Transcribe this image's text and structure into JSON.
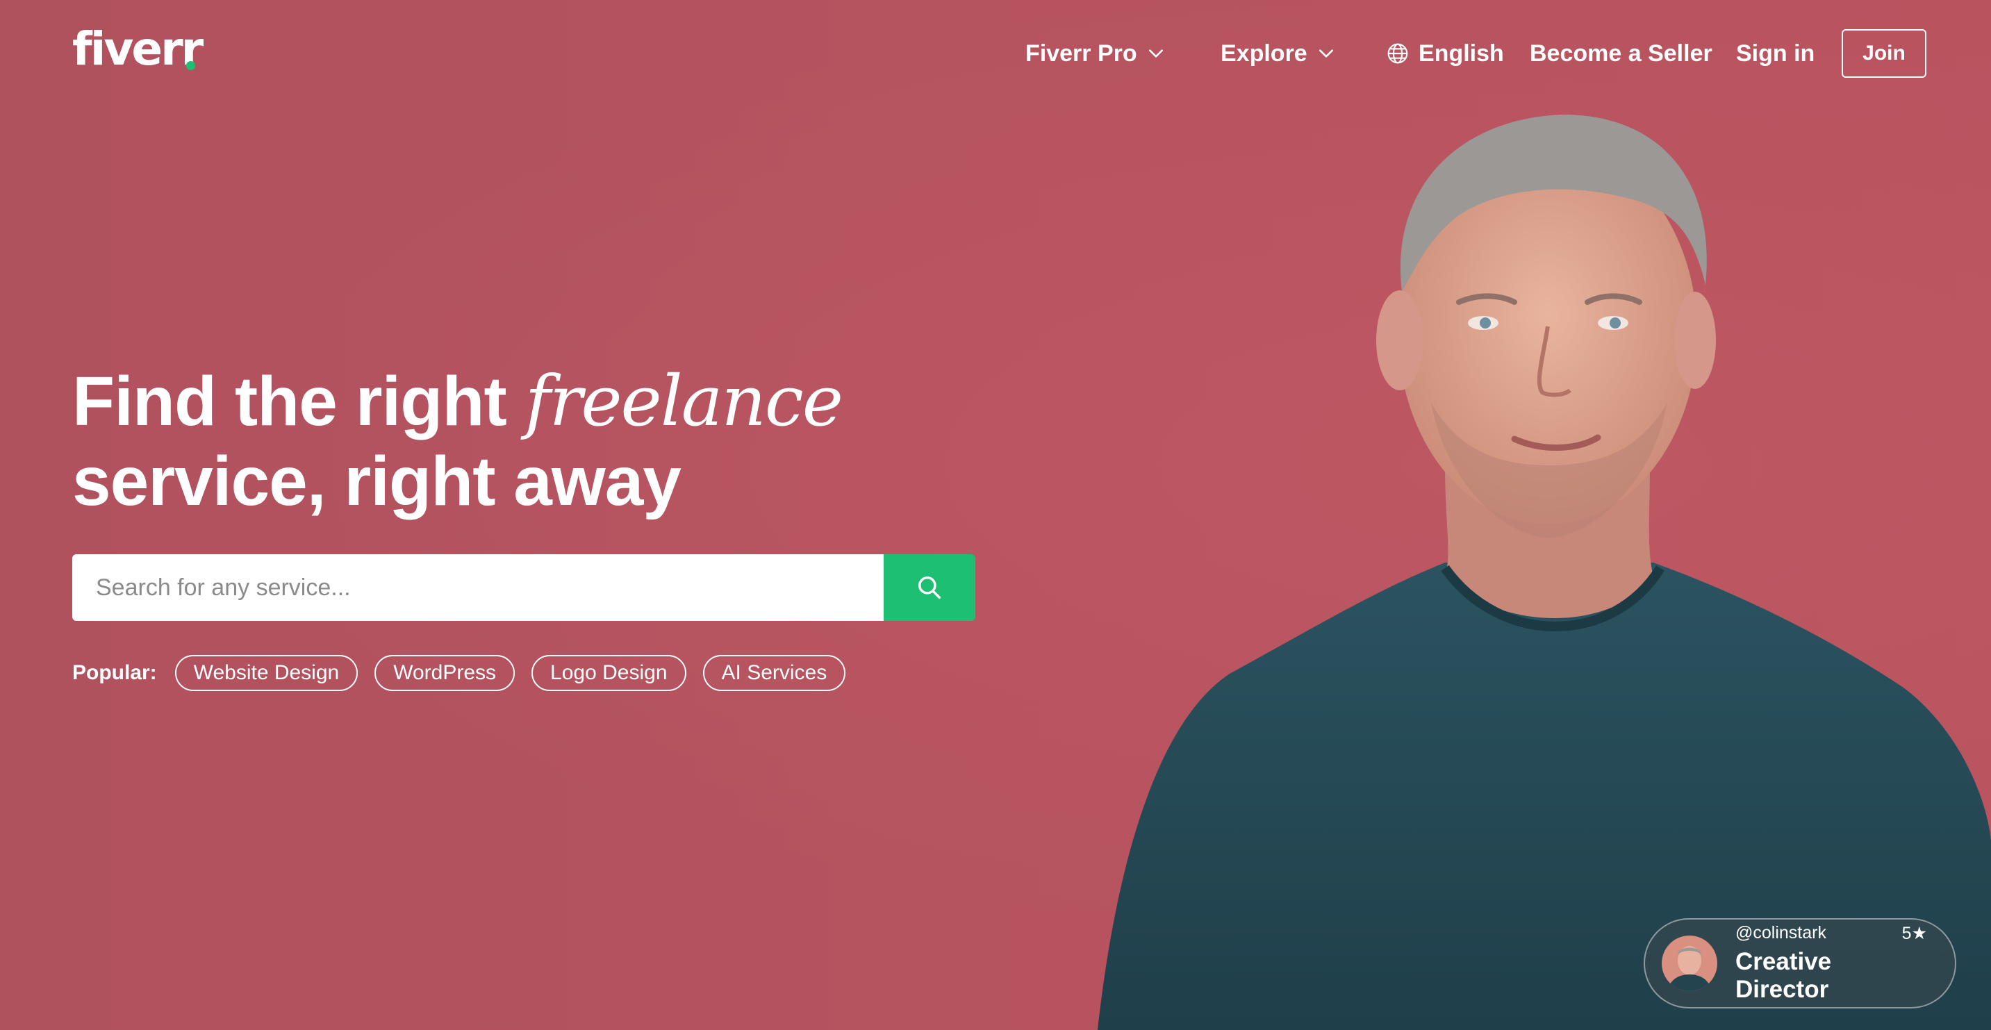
{
  "brand": {
    "logo_text": "fiverr",
    "dot_color": "#1dbf73"
  },
  "nav": {
    "fiverr_pro": "Fiverr Pro",
    "explore": "Explore",
    "language": "English",
    "become_seller": "Become a Seller",
    "sign_in": "Sign in",
    "join": "Join"
  },
  "hero": {
    "headline_part1": "Find the right ",
    "headline_em": "freelance",
    "headline_part2": "service, right away",
    "search_placeholder": "Search for any service...",
    "popular_label": "Popular:",
    "popular_tags": [
      "Website Design",
      "WordPress",
      "Logo Design",
      "AI Services"
    ]
  },
  "seller_card": {
    "handle": "@colinstark",
    "rating": "5★",
    "role": "Creative Director"
  },
  "icons": [
    "chevron-down-icon",
    "globe-icon",
    "search-icon"
  ],
  "colors": {
    "background": "#b5535f",
    "accent": "#1dbf73",
    "shirt": "#24454f"
  }
}
